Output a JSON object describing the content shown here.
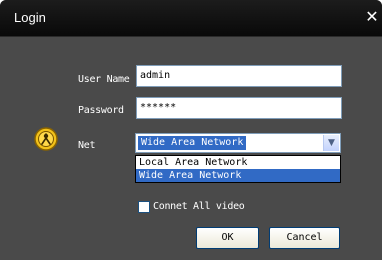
{
  "window": {
    "title": "Login",
    "close_glyph": "✕"
  },
  "icon": "lock-icon",
  "form": {
    "user_name_label": "User Name",
    "user_name_value": "admin",
    "password_label": "Password",
    "password_value": "******",
    "net_label": "Net",
    "net_selected": "Wide Area Network",
    "net_options": [
      "Local Area Network",
      "Wide Area Network"
    ],
    "connect_all_label": "Connet All video",
    "connect_all_checked": false
  },
  "buttons": {
    "ok_label": "OK",
    "cancel_label": "Cancel"
  },
  "colors": {
    "title_bar": "#111111",
    "dialog_body": "#4a4a4a",
    "selection": "#316ac5",
    "icon_yellow": "#f3c21a"
  }
}
